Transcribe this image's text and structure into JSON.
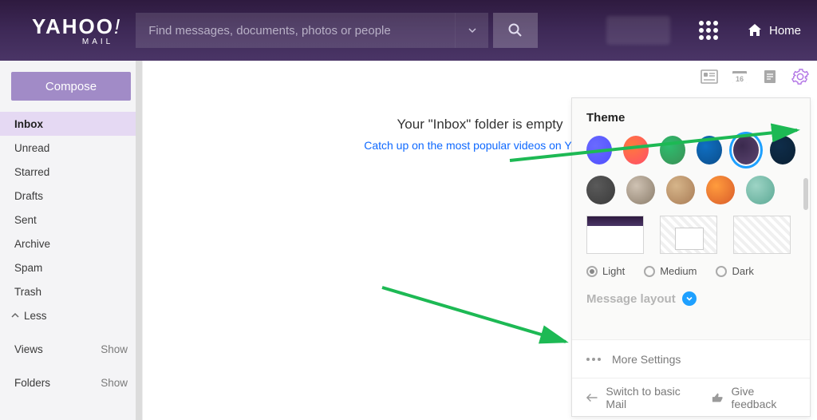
{
  "logo": {
    "main": "YAHOO",
    "bang": "!",
    "sub": "MAIL"
  },
  "search": {
    "placeholder": "Find messages, documents, photos or people"
  },
  "header": {
    "home_label": "Home"
  },
  "sidebar": {
    "compose": "Compose",
    "items": [
      {
        "label": "Inbox",
        "active": true
      },
      {
        "label": "Unread"
      },
      {
        "label": "Starred"
      },
      {
        "label": "Drafts"
      },
      {
        "label": "Sent"
      },
      {
        "label": "Archive"
      },
      {
        "label": "Spam"
      },
      {
        "label": "Trash"
      }
    ],
    "less_label": "Less",
    "sections": {
      "views": {
        "label": "Views",
        "action": "Show"
      },
      "folders": {
        "label": "Folders",
        "action": "Show"
      }
    }
  },
  "main": {
    "empty_title": "Your \"Inbox\" folder is empty",
    "empty_link": "Catch up on the most popular videos on Yahoo"
  },
  "settings": {
    "theme_title": "Theme",
    "swatches_row1": [
      {
        "color1": "#6a6aff",
        "color2": "#5050ff"
      },
      {
        "color1": "#ff7a3d",
        "color2": "#ff4d6a"
      },
      {
        "color1": "#2dbd6e",
        "color2": "#3b8f55"
      },
      {
        "color1": "#0f6fc2",
        "color2": "#0b4e8c"
      },
      {
        "color1": "#3b2a4e",
        "color2": "#5b4570",
        "selected": true
      },
      {
        "color1": "#0f2d4a",
        "color2": "#0a2034"
      }
    ],
    "swatches_row2": [
      {
        "color1": "#5a5a5a",
        "color2": "#3a3a3a"
      },
      {
        "color1": "#cfc2b3",
        "color2": "#8a7c6a"
      },
      {
        "color1": "#d6b58a",
        "color2": "#a87b55"
      },
      {
        "color1": "#ff9c3d",
        "color2": "#d95b2a"
      },
      {
        "color1": "#9dd4c5",
        "color2": "#5ba894"
      }
    ],
    "modes": {
      "light": "Light",
      "medium": "Medium",
      "dark": "Dark",
      "selected": "light"
    },
    "message_layout": "Message layout",
    "more_settings": "More Settings",
    "basic_mail": "Switch to basic Mail",
    "feedback": "Give feedback"
  },
  "top_icons": {
    "calendar_badge": "16"
  }
}
